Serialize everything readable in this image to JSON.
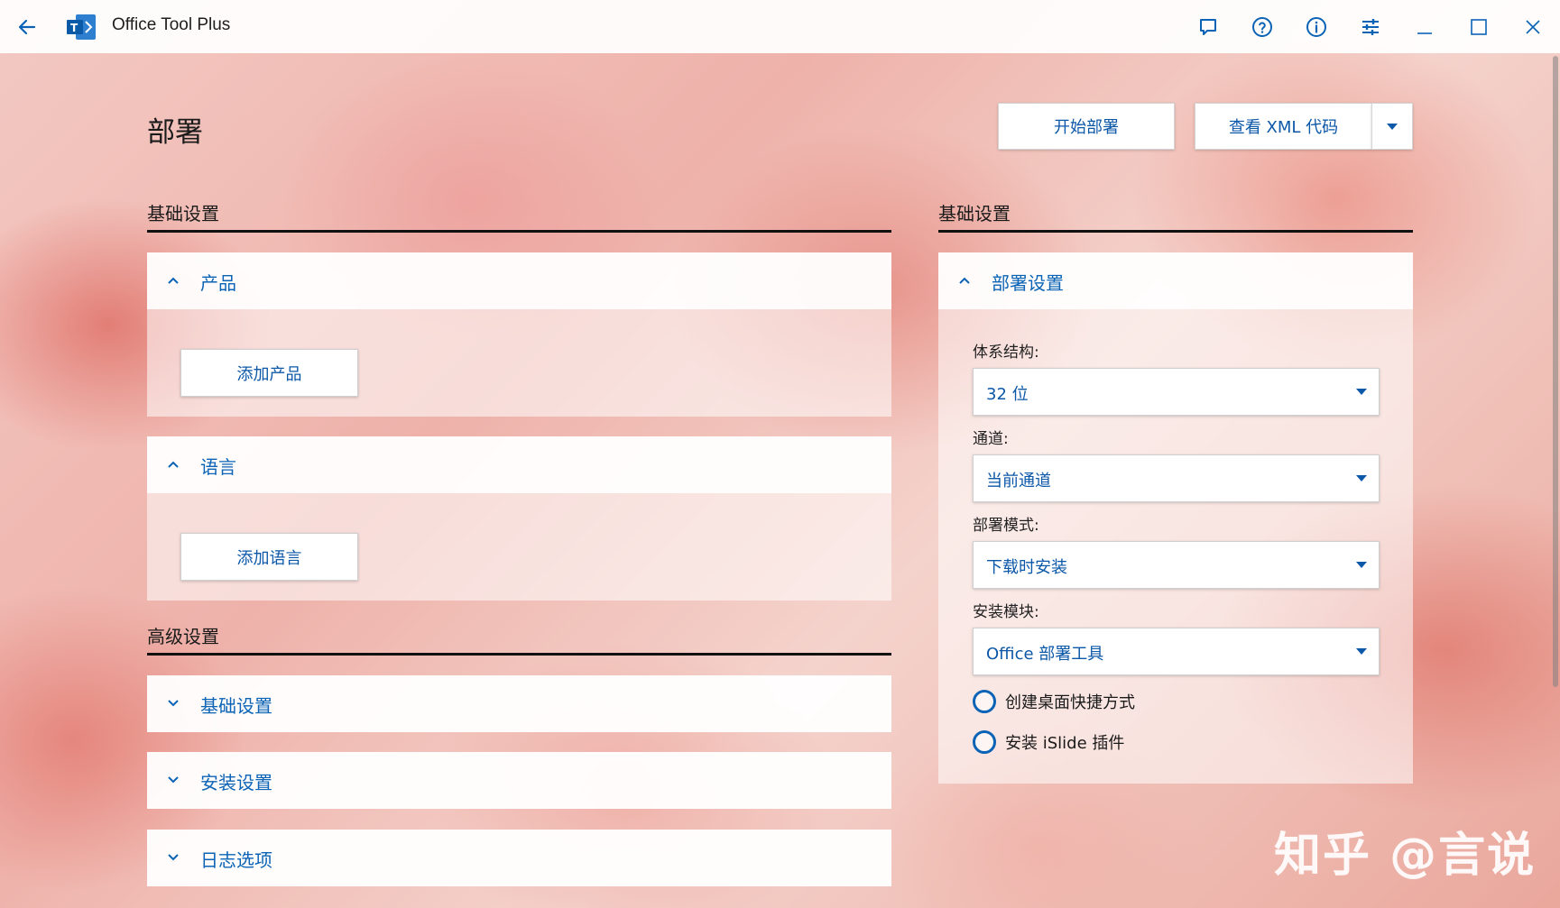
{
  "app": {
    "title": "Office Tool Plus",
    "titlebar_icons": [
      "back-icon",
      "chat-icon",
      "help-icon",
      "info-icon",
      "settings-sliders-icon",
      "minimize-icon",
      "maximize-icon",
      "close-icon"
    ]
  },
  "page": {
    "title": "部署",
    "start_button": "开始部署",
    "xml_button": "查看 XML 代码"
  },
  "left": {
    "basic_header": "基础设置",
    "product_panel": {
      "title": "产品",
      "button": "添加产品",
      "expanded": true
    },
    "language_panel": {
      "title": "语言",
      "button": "添加语言",
      "expanded": true
    },
    "advanced_header": "高级设置",
    "advanced_panels": [
      {
        "title": "基础设置",
        "expanded": false
      },
      {
        "title": "安装设置",
        "expanded": false
      },
      {
        "title": "日志选项",
        "expanded": false
      }
    ]
  },
  "right": {
    "basic_header": "基础设置",
    "deploy_panel": {
      "title": "部署设置",
      "fields": [
        {
          "label": "体系结构:",
          "value": "32 位"
        },
        {
          "label": "通道:",
          "value": "当前通道"
        },
        {
          "label": "部署模式:",
          "value": "下载时安装"
        },
        {
          "label": "安装模块:",
          "value": "Office 部署工具"
        }
      ],
      "options": [
        {
          "label": "创建桌面快捷方式",
          "checked": false
        },
        {
          "label": "安装 iSlide 插件",
          "checked": false
        }
      ]
    }
  },
  "watermark": "知乎 @言说",
  "colors": {
    "accent": "#0b63b6",
    "link_text": "#0b57a8"
  }
}
